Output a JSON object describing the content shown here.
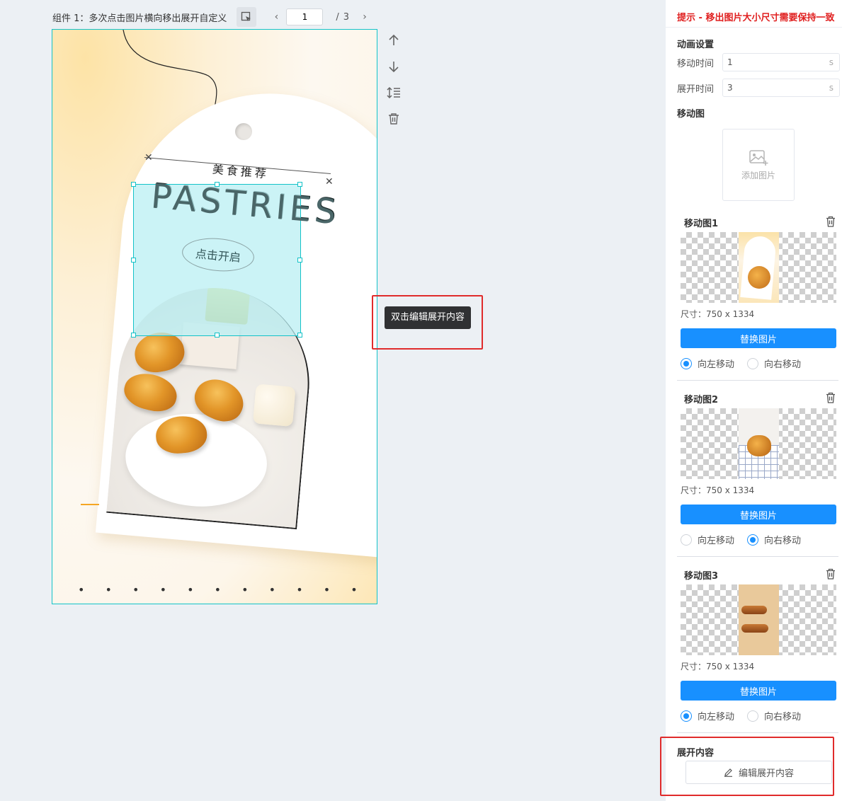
{
  "toolbar": {
    "component_title": "组件 1：多次点击图片横向移出展开自定义",
    "current_page": "1",
    "page_separator": "/",
    "total_pages": "3",
    "prev_icon": "chevron-left-icon",
    "next_icon": "chevron-right-icon"
  },
  "canvas": {
    "subtitle": "美食推荐",
    "headline": "PASTRIES",
    "open_button": "点击开启",
    "tooltip": "双击编辑展开内容",
    "dots": "• • • • • • • • • • • • • • • • • • •"
  },
  "side_tools": [
    "arrow-up-icon",
    "arrow-down-icon",
    "line-height-icon",
    "trash-icon"
  ],
  "panel": {
    "tip": "提示 - 移出图片大小尺寸需要保持一致",
    "animation_title": "动画设置",
    "move_time_label": "移动时间",
    "move_time_value": "1",
    "move_time_unit": "s",
    "expand_time_label": "展开时间",
    "expand_time_value": "3",
    "expand_time_unit": "s",
    "move_image_title": "移动图",
    "add_image_label": "添加图片",
    "images": [
      {
        "title": "移动图1",
        "size": "尺寸：750 x 1334",
        "replace": "替换图片",
        "left_label": "向左移动",
        "right_label": "向右移动",
        "direction": "left"
      },
      {
        "title": "移动图2",
        "size": "尺寸：750 x 1334",
        "replace": "替换图片",
        "left_label": "向左移动",
        "right_label": "向右移动",
        "direction": "right"
      },
      {
        "title": "移动图3",
        "size": "尺寸：750 x 1334",
        "replace": "替换图片",
        "left_label": "向左移动",
        "right_label": "向右移动",
        "direction": "left"
      }
    ],
    "expand_title": "展开内容",
    "edit_expand_label": "编辑展开内容"
  },
  "colors": {
    "accent": "#1890ff",
    "selection": "#14c2c8",
    "warning": "#e02020"
  }
}
